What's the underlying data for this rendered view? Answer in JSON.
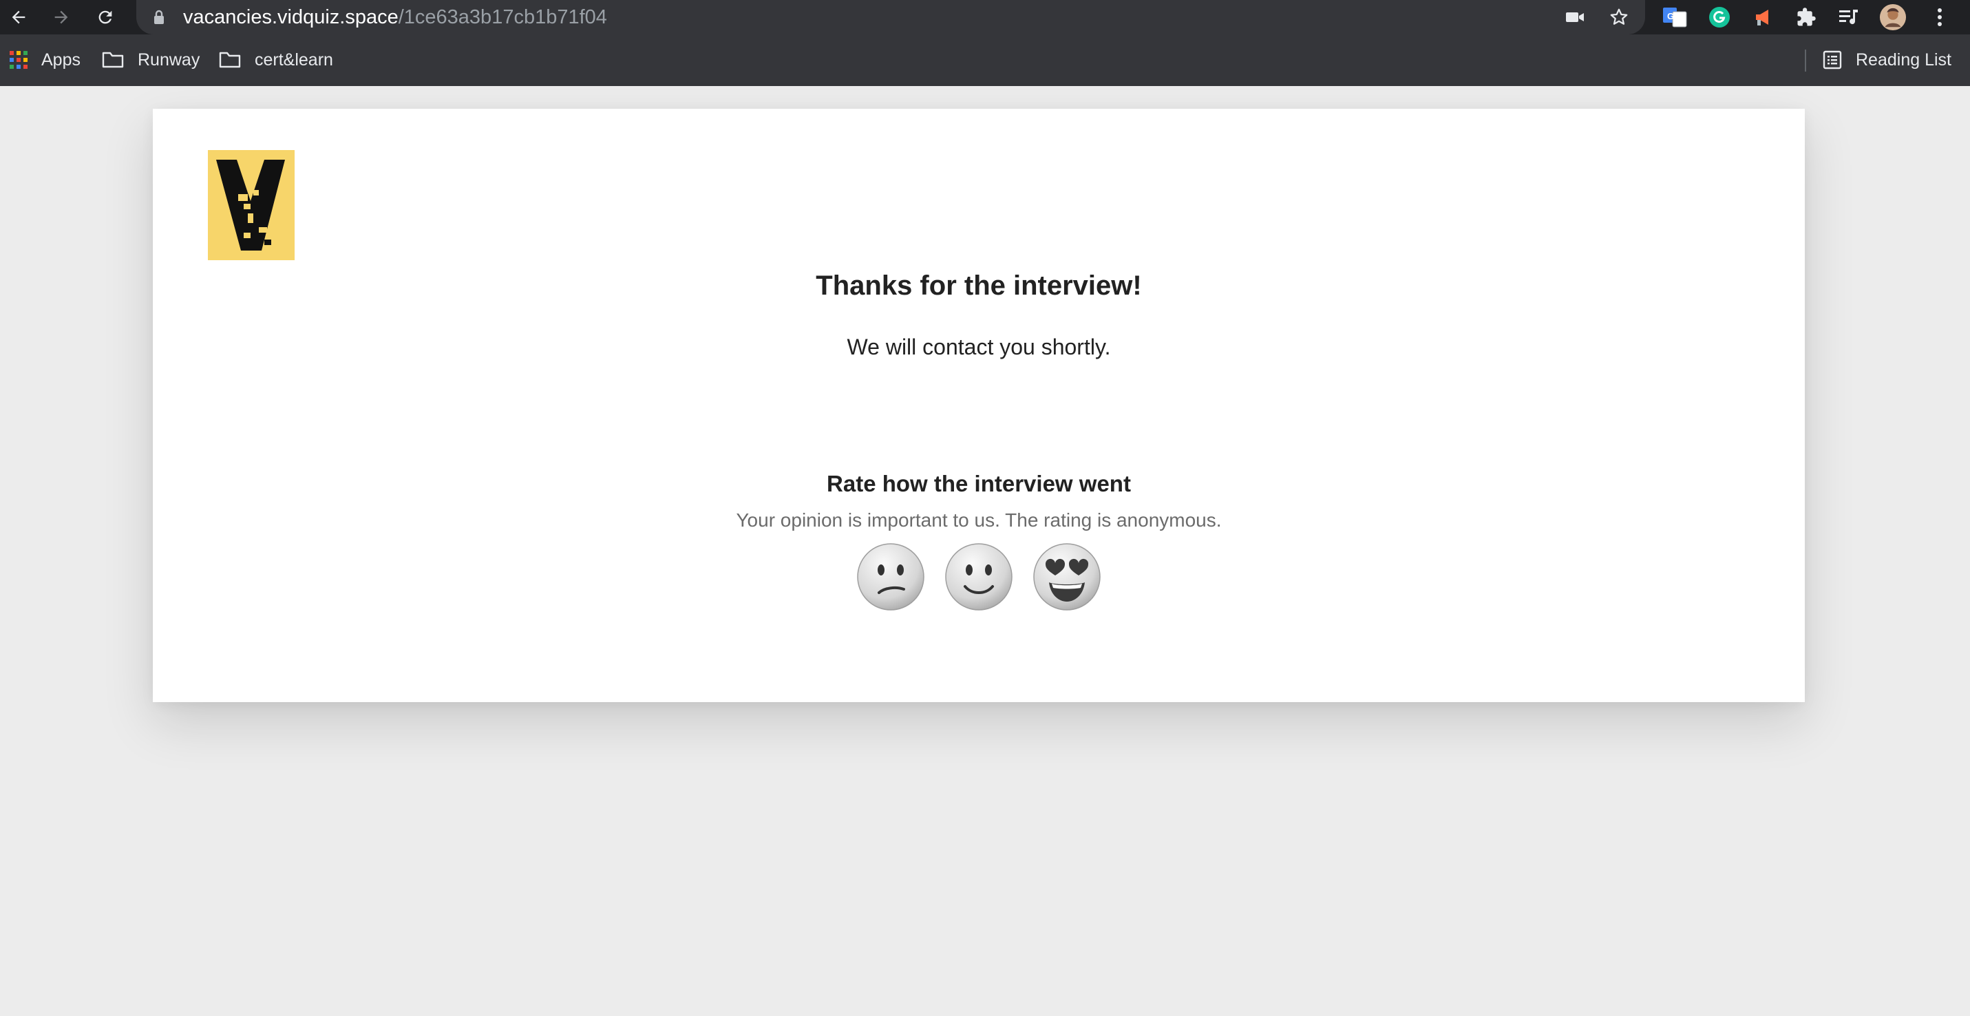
{
  "browser": {
    "url_host": "vacancies.vidquiz.space",
    "url_path": "/1ce63a3b17cb1b71f04",
    "bookmarks": [
      {
        "label": "Apps"
      },
      {
        "label": "Runway"
      },
      {
        "label": "cert&learn"
      }
    ],
    "reading_list_label": "Reading List"
  },
  "page": {
    "title": "Thanks for the interview!",
    "subtitle": "We will contact you shortly.",
    "rating": {
      "heading": "Rate how the interview went",
      "note": "Your opinion is important to us. The rating is anonymous.",
      "options": [
        {
          "icon": "confused-face-icon"
        },
        {
          "icon": "slightly-smiling-face-icon"
        },
        {
          "icon": "heart-eyes-face-icon"
        }
      ]
    }
  },
  "colors": {
    "chrome_dark": "#202124",
    "chrome_bar": "#35363a",
    "logo_bg": "#f7d56a",
    "logo_fg": "#111111"
  }
}
